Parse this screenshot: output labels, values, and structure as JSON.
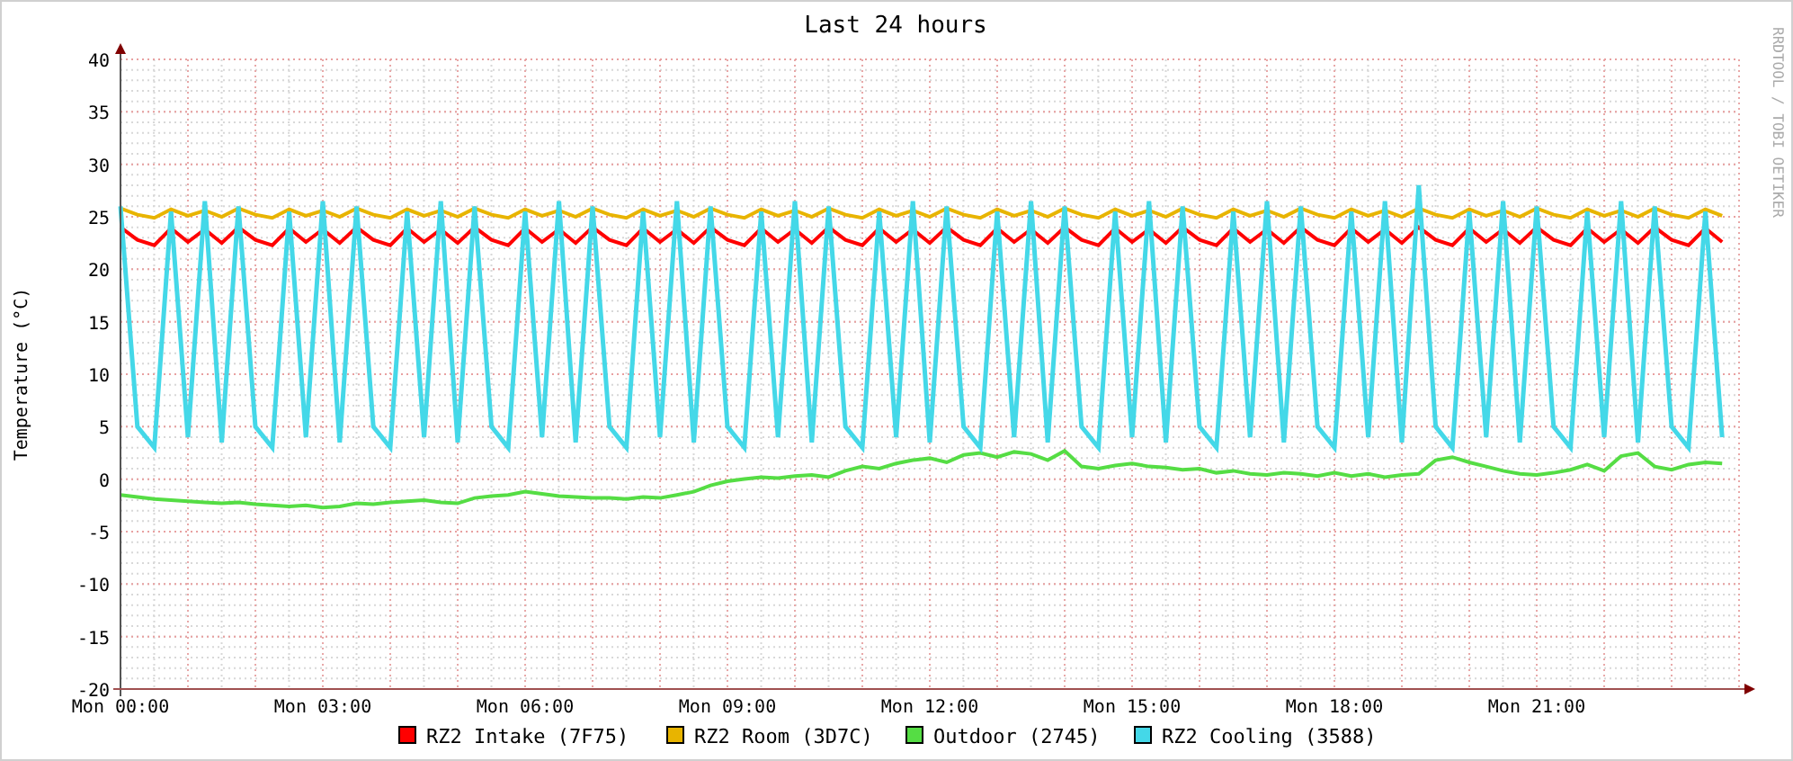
{
  "graph": {
    "credit": "RRDTOOL / TOBI OETIKER",
    "chart_data": {
      "type": "line",
      "title": "Last 24 hours",
      "ylabel": "Temperature (°C)",
      "ylim": [
        -20,
        40
      ],
      "grid": true,
      "legend": "bottom",
      "categories": [
        "Mon 00:00",
        null,
        null,
        null,
        null,
        null,
        null,
        null,
        null,
        null,
        null,
        null,
        "Mon 03:00",
        null,
        null,
        null,
        null,
        null,
        null,
        null,
        null,
        null,
        null,
        null,
        "Mon 06:00",
        null,
        null,
        null,
        null,
        null,
        null,
        null,
        null,
        null,
        null,
        null,
        "Mon 09:00",
        null,
        null,
        null,
        null,
        null,
        null,
        null,
        null,
        null,
        null,
        null,
        "Mon 12:00",
        null,
        null,
        null,
        null,
        null,
        null,
        null,
        null,
        null,
        null,
        null,
        "Mon 15:00",
        null,
        null,
        null,
        null,
        null,
        null,
        null,
        null,
        null,
        null,
        null,
        "Mon 18:00",
        null,
        null,
        null,
        null,
        null,
        null,
        null,
        null,
        null,
        null,
        null,
        "Mon 21:00",
        null,
        null,
        null,
        null,
        null,
        null,
        null,
        null,
        null,
        null,
        null
      ],
      "yticks": [
        {
          "value": -20,
          "label": "-20"
        },
        {
          "value": -15,
          "label": "-15"
        },
        {
          "value": -10,
          "label": "-10"
        },
        {
          "value": -5,
          "label": "-5"
        },
        {
          "value": 0,
          "label": "0"
        },
        {
          "value": 5,
          "label": "5"
        },
        {
          "value": 10,
          "label": "10"
        },
        {
          "value": 15,
          "label": "15"
        },
        {
          "value": 20,
          "label": "20"
        },
        {
          "value": 25,
          "label": "25"
        },
        {
          "value": 30,
          "label": "30"
        },
        {
          "value": 35,
          "label": "35"
        },
        {
          "value": 40,
          "label": "40"
        }
      ],
      "series": [
        {
          "name": "RZ2 Intake (7F75)",
          "color": "#ff0000",
          "values": [
            24,
            22.8,
            22.3,
            23.9,
            22.6,
            23.8,
            22.5,
            24,
            22.8,
            22.3,
            23.9,
            22.6,
            23.8,
            22.5,
            24,
            22.8,
            22.3,
            23.9,
            22.6,
            23.8,
            22.5,
            24,
            22.8,
            22.3,
            23.9,
            22.6,
            23.8,
            22.5,
            24,
            22.8,
            22.3,
            23.9,
            22.6,
            23.8,
            22.5,
            24,
            22.8,
            22.3,
            23.9,
            22.6,
            23.8,
            22.5,
            24,
            22.8,
            22.3,
            23.9,
            22.6,
            23.8,
            22.5,
            24,
            22.8,
            22.3,
            23.9,
            22.6,
            23.8,
            22.5,
            24,
            22.8,
            22.3,
            23.9,
            22.6,
            23.8,
            22.5,
            24,
            22.8,
            22.3,
            23.9,
            22.6,
            23.8,
            22.5,
            24,
            22.8,
            22.3,
            23.9,
            22.6,
            23.8,
            22.5,
            24,
            22.8,
            22.3,
            23.9,
            22.6,
            23.8,
            22.5,
            24,
            22.8,
            22.3,
            23.9,
            22.6,
            23.8,
            22.5,
            24,
            22.8,
            22.3,
            23.9,
            22.6
          ]
        },
        {
          "name": "RZ2 Room (3D7C)",
          "color": "#e8b400",
          "values": [
            25.8,
            25.2,
            24.9,
            25.7,
            25.1,
            25.6,
            25,
            25.8,
            25.2,
            24.9,
            25.7,
            25.1,
            25.6,
            25,
            25.8,
            25.2,
            24.9,
            25.7,
            25.1,
            25.6,
            25,
            25.8,
            25.2,
            24.9,
            25.7,
            25.1,
            25.6,
            25,
            25.8,
            25.2,
            24.9,
            25.7,
            25.1,
            25.6,
            25,
            25.8,
            25.2,
            24.9,
            25.7,
            25.1,
            25.6,
            25,
            25.8,
            25.2,
            24.9,
            25.7,
            25.1,
            25.6,
            25,
            25.8,
            25.2,
            24.9,
            25.7,
            25.1,
            25.6,
            25,
            25.8,
            25.2,
            24.9,
            25.7,
            25.1,
            25.6,
            25,
            25.8,
            25.2,
            24.9,
            25.7,
            25.1,
            25.6,
            25,
            25.8,
            25.2,
            24.9,
            25.7,
            25.1,
            25.6,
            25,
            25.8,
            25.2,
            24.9,
            25.7,
            25.1,
            25.6,
            25,
            25.8,
            25.2,
            24.9,
            25.7,
            25.1,
            25.6,
            25,
            25.8,
            25.2,
            24.9,
            25.7,
            25.1
          ]
        },
        {
          "name": "Outdoor (2745)",
          "color": "#55dd44",
          "values": [
            -1.5,
            -1.7,
            -1.9,
            -2,
            -2.1,
            -2.2,
            -2.3,
            -2.2,
            -2.4,
            -2.5,
            -2.6,
            -2.5,
            -2.7,
            -2.6,
            -2.3,
            -2.4,
            -2.2,
            -2.1,
            -2,
            -2.2,
            -2.3,
            -1.8,
            -1.6,
            -1.5,
            -1.2,
            -1.4,
            -1.6,
            -1.7,
            -1.8,
            -1.8,
            -1.9,
            -1.7,
            -1.8,
            -1.5,
            -1.2,
            -0.6,
            -0.2,
            0,
            0.2,
            0.1,
            0.3,
            0.4,
            0.2,
            0.8,
            1.2,
            1,
            1.5,
            1.8,
            2,
            1.6,
            2.3,
            2.5,
            2.1,
            2.6,
            2.4,
            1.8,
            2.7,
            1.2,
            1,
            1.3,
            1.5,
            1.2,
            1.1,
            0.9,
            1,
            0.6,
            0.8,
            0.5,
            0.4,
            0.6,
            0.5,
            0.3,
            0.6,
            0.3,
            0.5,
            0.2,
            0.4,
            0.5,
            1.8,
            2.1,
            1.6,
            1.2,
            0.8,
            0.5,
            0.4,
            0.6,
            0.9,
            1.4,
            0.8,
            2.2,
            2.5,
            1.2,
            0.9,
            1.4,
            1.6,
            1.5
          ]
        },
        {
          "name": "RZ2 Cooling (3588)",
          "color": "#44d8e8",
          "values": [
            26,
            5,
            3,
            25.5,
            4,
            26.5,
            3.5,
            26,
            5,
            3,
            25.5,
            4,
            26.5,
            3.5,
            26,
            5,
            3,
            25.5,
            4,
            26.5,
            3.5,
            26,
            5,
            3,
            25.5,
            4,
            26.5,
            3.5,
            26,
            5,
            3,
            25.5,
            4,
            26.5,
            3.5,
            26,
            5,
            3,
            25.5,
            4,
            26.5,
            3.5,
            26,
            5,
            3,
            25.5,
            4,
            26.5,
            3.5,
            26,
            5,
            3,
            25.5,
            4,
            26.5,
            3.5,
            26,
            5,
            3,
            25.5,
            4,
            26.5,
            3.5,
            26,
            5,
            3,
            25.5,
            4,
            26.5,
            3.5,
            26,
            5,
            3,
            25.5,
            4,
            26.5,
            3.5,
            28,
            5,
            3,
            25.5,
            4,
            26.5,
            3.5,
            26,
            5,
            3,
            25.5,
            4,
            26.5,
            3.5,
            26,
            5,
            3,
            25.5,
            4
          ]
        }
      ]
    }
  }
}
